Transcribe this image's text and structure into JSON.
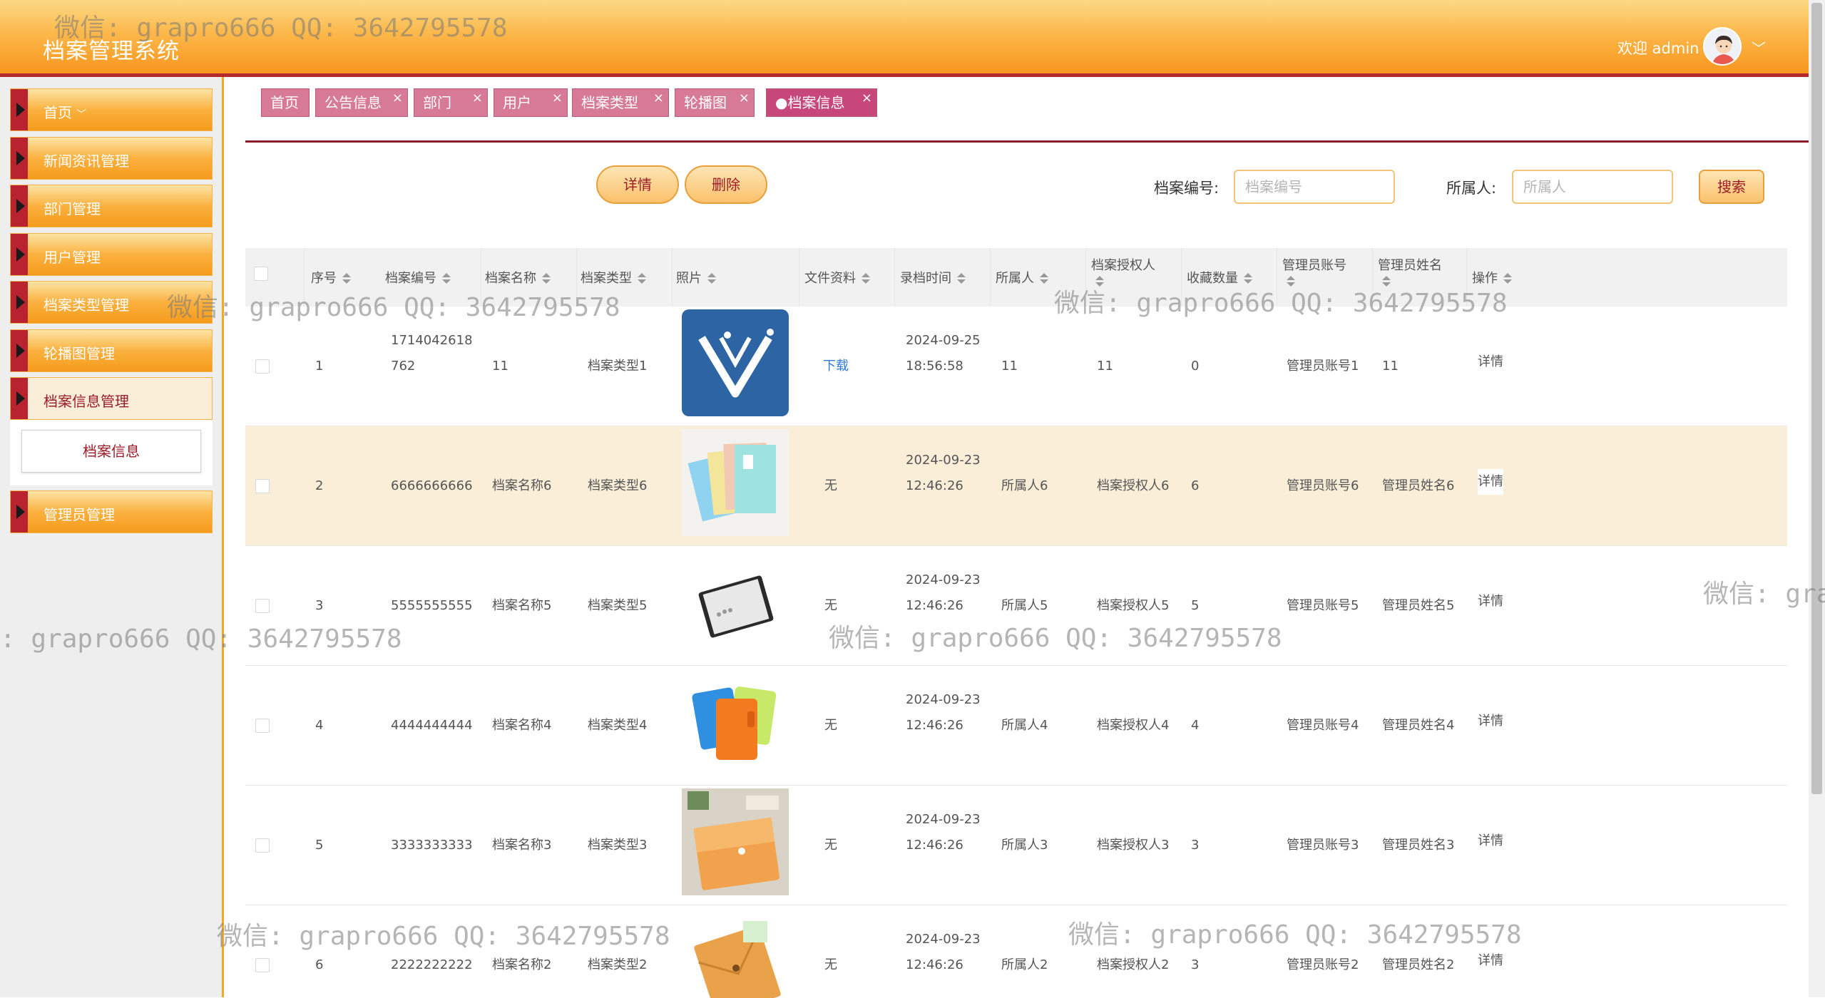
{
  "header": {
    "app_title": "档案管理系统",
    "welcome_text": "欢迎 admin",
    "chevron": "﹀"
  },
  "sidebar": {
    "items": [
      {
        "label": "首页",
        "chev": "﹀"
      },
      {
        "label": "新闻资讯管理"
      },
      {
        "label": "部门管理"
      },
      {
        "label": "用户管理"
      },
      {
        "label": "档案类型管理"
      },
      {
        "label": "轮播图管理"
      },
      {
        "label": "档案信息管理"
      },
      {
        "label": "管理员管理"
      }
    ],
    "submenu_label": "档案信息"
  },
  "tabs": [
    {
      "label": "首页"
    },
    {
      "label": "公告信息",
      "close": "×"
    },
    {
      "label": "部门",
      "close": "×"
    },
    {
      "label": "用户",
      "close": "×"
    },
    {
      "label": "档案类型",
      "close": "×"
    },
    {
      "label": "轮播图",
      "close": "×"
    },
    {
      "label": "●档案信息",
      "close": "×"
    }
  ],
  "toolbar": {
    "detail_label": "详情",
    "delete_label": "删除",
    "archive_no_label": "档案编号:",
    "archive_no_placeholder": "档案编号",
    "owner_label": "所属人:",
    "owner_placeholder": "所属人",
    "search_label": "搜索"
  },
  "table": {
    "columns": {
      "seq": "序号",
      "archive_no": "档案编号",
      "archive_name": "档案名称",
      "archive_type": "档案类型",
      "photo": "照片",
      "files": "文件资料",
      "record_time": "录档时间",
      "owner": "所属人",
      "authorized": "档案授权人",
      "favorites": "收藏数量",
      "admin_account": "管理员账号",
      "admin_name": "管理员姓名",
      "actions": "操作"
    },
    "rows": [
      {
        "seq": "1",
        "no_line1": "1714042618",
        "no_line2": "762",
        "name": "11",
        "type": "档案类型1",
        "file": "下载",
        "date": "2024-09-25",
        "time": "18:56:58",
        "owner": "11",
        "auth": "11",
        "fav": "0",
        "account": "管理员账号1",
        "admin": "11",
        "action": "详情"
      },
      {
        "seq": "2",
        "no_line1": "6666666666",
        "no_line2": "",
        "name": "档案名称6",
        "type": "档案类型6",
        "file": "无",
        "date": "2024-09-23",
        "time": "12:46:26",
        "owner": "所属人6",
        "auth": "档案授权人6",
        "fav": "6",
        "account": "管理员账号6",
        "admin": "管理员姓名6",
        "action": "详情"
      },
      {
        "seq": "3",
        "no_line1": "5555555555",
        "no_line2": "",
        "name": "档案名称5",
        "type": "档案类型5",
        "file": "无",
        "date": "2024-09-23",
        "time": "12:46:26",
        "owner": "所属人5",
        "auth": "档案授权人5",
        "fav": "5",
        "account": "管理员账号5",
        "admin": "管理员姓名5",
        "action": "详情"
      },
      {
        "seq": "4",
        "no_line1": "4444444444",
        "no_line2": "",
        "name": "档案名称4",
        "type": "档案类型4",
        "file": "无",
        "date": "2024-09-23",
        "time": "12:46:26",
        "owner": "所属人4",
        "auth": "档案授权人4",
        "fav": "4",
        "account": "管理员账号4",
        "admin": "管理员姓名4",
        "action": "详情"
      },
      {
        "seq": "5",
        "no_line1": "3333333333",
        "no_line2": "",
        "name": "档案名称3",
        "type": "档案类型3",
        "file": "无",
        "date": "2024-09-23",
        "time": "12:46:26",
        "owner": "所属人3",
        "auth": "档案授权人3",
        "fav": "3",
        "account": "管理员账号3",
        "admin": "管理员姓名3",
        "action": "详情"
      },
      {
        "seq": "6",
        "no_line1": "2222222222",
        "no_line2": "",
        "name": "档案名称2",
        "type": "档案类型2",
        "file": "无",
        "date": "2024-09-23",
        "time": "12:46:26",
        "owner": "所属人2",
        "auth": "档案授权人2",
        "fav": "3",
        "account": "管理员账号2",
        "admin": "管理员姓名2",
        "action": "详情"
      }
    ]
  },
  "watermarks": {
    "full": "微信: grapro666 QQ: 3642795578",
    "left_cut": ": grapro666 QQ: 3642795578",
    "right_cut": "微信: gra"
  }
}
